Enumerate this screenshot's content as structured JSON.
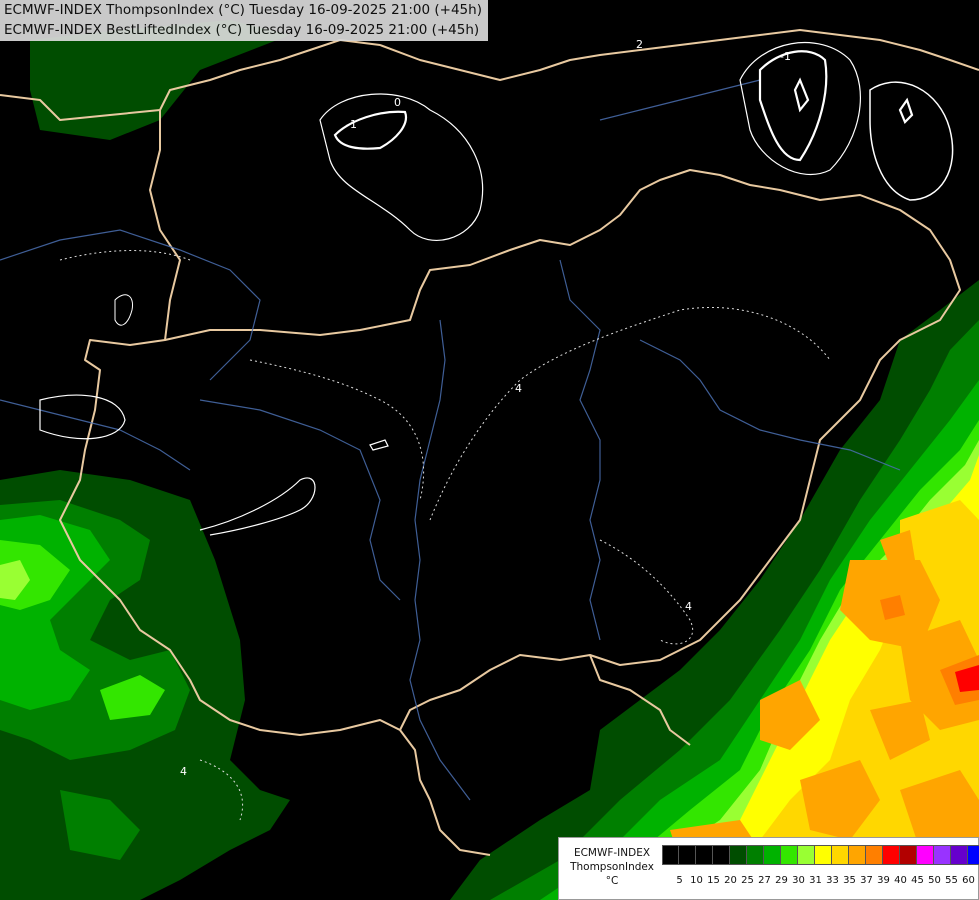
{
  "header": {
    "line1": "ECMWF-INDEX ThompsonIndex (°C) Tuesday 16-09-2025 21:00 (+45h)",
    "line2": "ECMWF-INDEX BestLiftedIndex (°C) Tuesday 16-09-2025 21:00 (+45h)"
  },
  "legend": {
    "title_line1": "ECMWF-INDEX",
    "title_line2": "ThompsonIndex",
    "title_line3": "°C",
    "ticks": [
      "5",
      "10",
      "15",
      "20",
      "25",
      "27",
      "29",
      "30",
      "31",
      "33",
      "35",
      "37",
      "39",
      "40",
      "45",
      "50",
      "55",
      "60"
    ],
    "colors": [
      "#000000",
      "#000000",
      "#000000",
      "#000000",
      "#004d00",
      "#007f00",
      "#00b200",
      "#33e600",
      "#99ff33",
      "#ffff00",
      "#ffd700",
      "#ffa500",
      "#ff7f00",
      "#ff0000",
      "#b20000",
      "#ff00ff",
      "#9933ff",
      "#6600cc",
      "#0000ff"
    ]
  },
  "map": {
    "contour_labels": [
      "0",
      "-1",
      "-1",
      "2",
      "4",
      "4",
      "4"
    ]
  }
}
